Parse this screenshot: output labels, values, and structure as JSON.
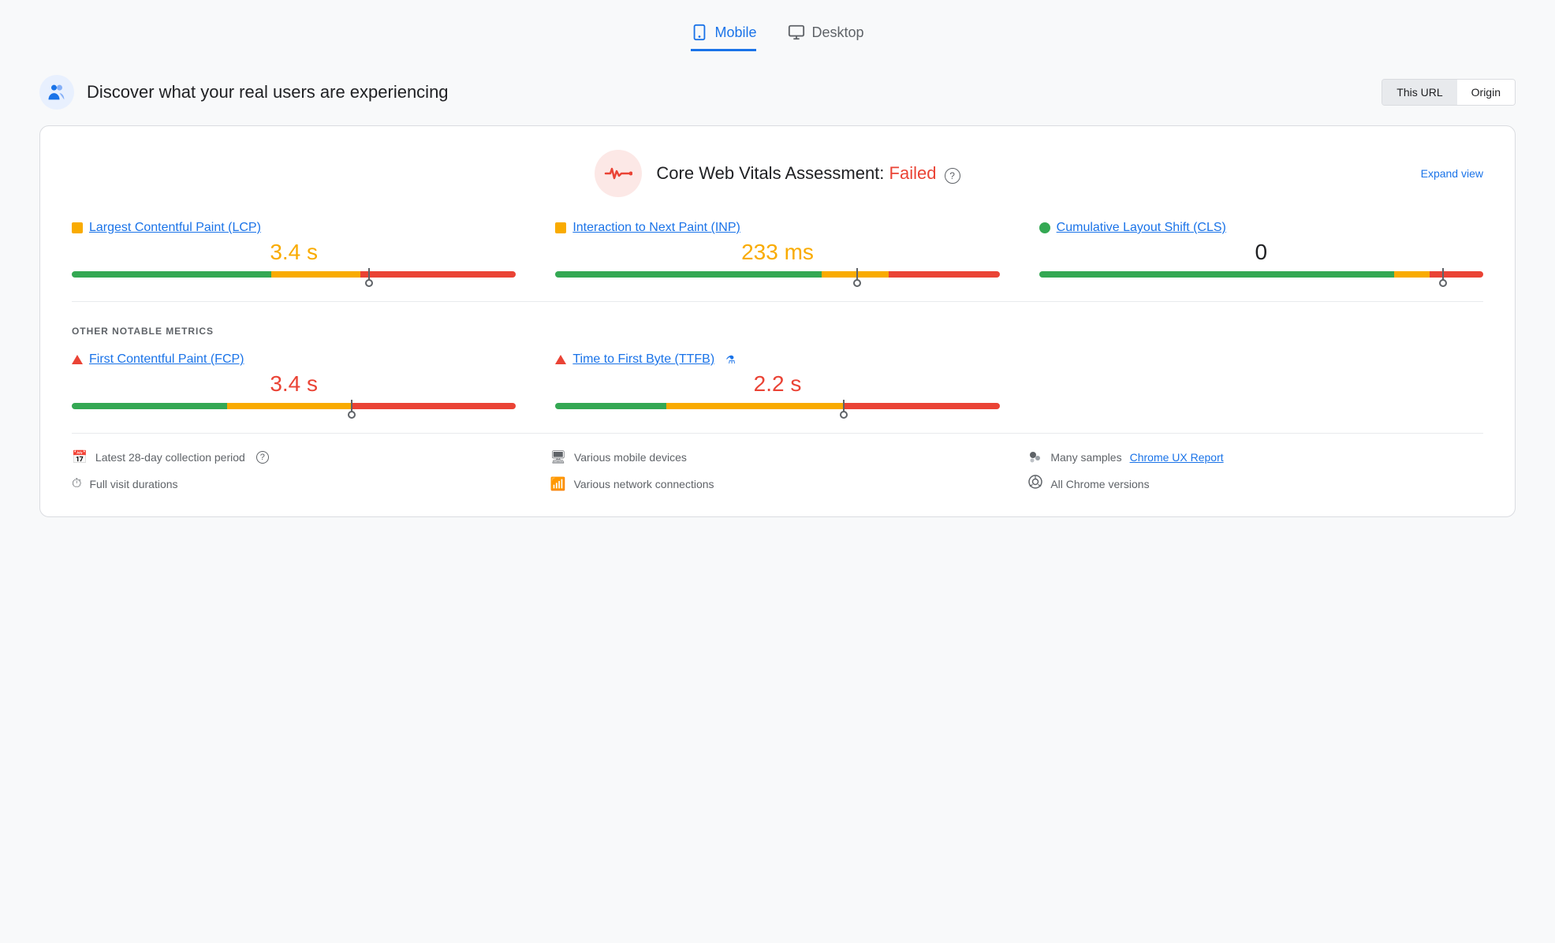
{
  "tabs": [
    {
      "id": "mobile",
      "label": "Mobile",
      "active": true
    },
    {
      "id": "desktop",
      "label": "Desktop",
      "active": false
    }
  ],
  "header": {
    "title": "Discover what your real users are experiencing",
    "url_toggle": {
      "this_url": "This URL",
      "origin": "Origin",
      "active": "this_url"
    }
  },
  "cwv": {
    "assessment_prefix": "Core Web Vitals Assessment: ",
    "assessment_status": "Failed",
    "expand_label": "Expand view"
  },
  "metrics": [
    {
      "id": "lcp",
      "name": "Largest Contentful Paint (LCP)",
      "dot_type": "orange_square",
      "value": "3.4 s",
      "value_color": "orange",
      "bar": {
        "green_pct": 45,
        "orange_pct": 20,
        "red_pct": 35,
        "marker_pct": 67
      }
    },
    {
      "id": "inp",
      "name": "Interaction to Next Paint (INP)",
      "dot_type": "orange_square",
      "value": "233 ms",
      "value_color": "orange",
      "bar": {
        "green_pct": 60,
        "orange_pct": 15,
        "red_pct": 25,
        "marker_pct": 68
      }
    },
    {
      "id": "cls",
      "name": "Cumulative Layout Shift (CLS)",
      "dot_type": "green_circle",
      "value": "0",
      "value_color": "black",
      "bar": {
        "green_pct": 80,
        "orange_pct": 8,
        "red_pct": 12,
        "marker_pct": 91
      }
    }
  ],
  "other_metrics_label": "OTHER NOTABLE METRICS",
  "other_metrics": [
    {
      "id": "fcp",
      "name": "First Contentful Paint (FCP)",
      "icon": "triangle",
      "value": "3.4 s",
      "value_color": "red",
      "bar": {
        "green_pct": 35,
        "orange_pct": 28,
        "red_pct": 37,
        "marker_pct": 63
      }
    },
    {
      "id": "ttfb",
      "name": "Time to First Byte (TTFB)",
      "icon": "triangle",
      "has_flask": true,
      "value": "2.2 s",
      "value_color": "red",
      "bar": {
        "green_pct": 25,
        "orange_pct": 40,
        "red_pct": 35,
        "marker_pct": 65
      }
    }
  ],
  "footer": {
    "items": [
      {
        "id": "collection",
        "icon": "📅",
        "text": "Latest 28-day collection period",
        "has_help": true
      },
      {
        "id": "devices",
        "icon": "🖥️",
        "text": "Various mobile devices"
      },
      {
        "id": "samples",
        "icon": "⚫",
        "text": "Many samples ",
        "link": "Chrome UX Report",
        "link_suffix": ""
      },
      {
        "id": "duration",
        "icon": "⏱️",
        "text": "Full visit durations"
      },
      {
        "id": "network",
        "icon": "📶",
        "text": "Various network connections"
      },
      {
        "id": "chrome",
        "icon": "🛡️",
        "text": "All Chrome versions"
      }
    ]
  }
}
